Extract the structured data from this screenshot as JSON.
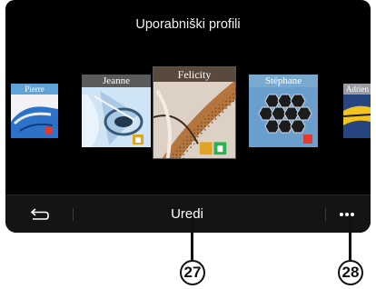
{
  "screen": {
    "title": "Uporabniški profili"
  },
  "profiles": [
    {
      "name": "Pierre",
      "state": "side"
    },
    {
      "name": "Jeanne",
      "state": "side"
    },
    {
      "name": "Felicity",
      "state": "selected"
    },
    {
      "name": "Stéphane",
      "state": "side"
    },
    {
      "name": "Adrien",
      "state": "side"
    }
  ],
  "bottom_bar": {
    "back_icon": "back-arrow-icon",
    "edit_label": "Uredi",
    "more_icon": "more-dots-icon"
  },
  "callouts": [
    "27",
    "28"
  ],
  "colors": {
    "screen_bg": "#000000",
    "bar_bg": "#141414",
    "lock": "#2bb24c",
    "badge": "#e0a422"
  }
}
